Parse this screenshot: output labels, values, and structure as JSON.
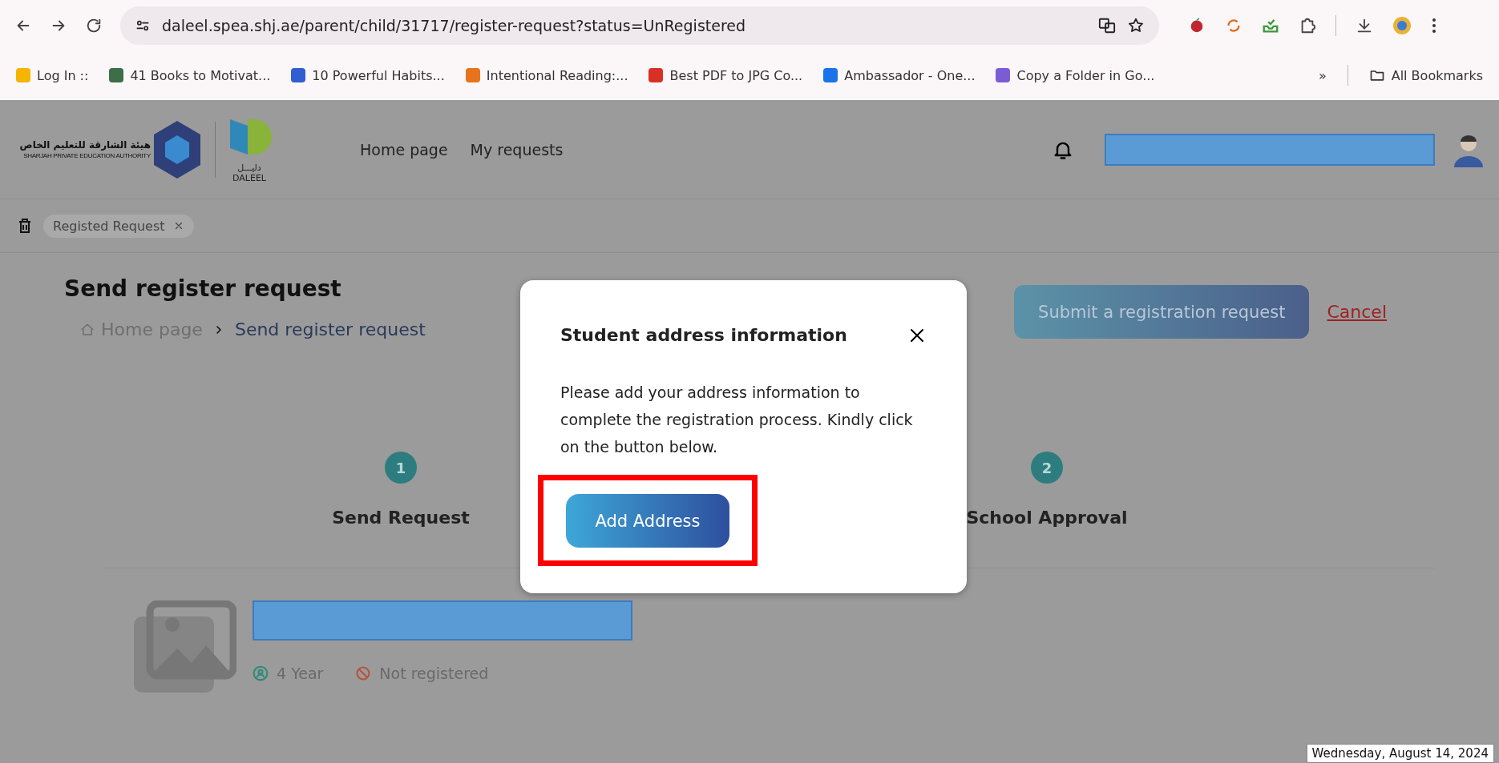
{
  "browser": {
    "url": "daleel.spea.shj.ae/parent/child/31717/register-request?status=UnRegistered",
    "bookmarks": [
      "Log In ::",
      "41 Books to Motivat...",
      "10 Powerful Habits...",
      "Intentional Reading:...",
      "Best PDF to JPG Co...",
      "Ambassador - One...",
      "Copy a Folder in Go..."
    ],
    "overflow": "»",
    "all_bookmarks": "All Bookmarks"
  },
  "header": {
    "logo_arabic": "هيئة الشارقة للتعليم الخاص",
    "logo_english": "SHARJAH PRIVATE EDUCATION AUTHORITY",
    "brand_arabic": "دليـــل",
    "brand": "DALEEL",
    "nav": [
      "Home page",
      "My requests"
    ]
  },
  "tags": [
    {
      "label": "Registed Request"
    }
  ],
  "page": {
    "title": "Send register request",
    "breadcrumb": [
      "Home page",
      "Send register request"
    ],
    "submit": "Submit a registration request",
    "cancel": "Cancel"
  },
  "steps": [
    {
      "number": "1",
      "label": "Send Request"
    },
    {
      "number": "2",
      "label": "School Approval"
    }
  ],
  "student": {
    "age": "4 Year",
    "status": "Not registered"
  },
  "modal": {
    "title": "Student address information",
    "body": "Please add your address information to complete the registration process. Kindly click on the button below.",
    "button": "Add Address"
  },
  "tooltip": "Wednesday, August 14, 2024"
}
